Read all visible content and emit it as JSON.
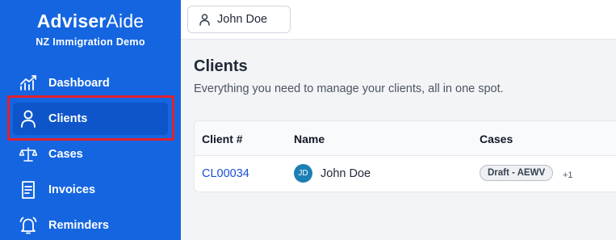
{
  "brand": {
    "title_bold": "Adviser",
    "title_light": "Aide",
    "subtitle": "NZ Immigration Demo"
  },
  "sidebar": {
    "items": [
      {
        "label": "Dashboard",
        "icon": "chart-icon"
      },
      {
        "label": "Clients",
        "icon": "user-icon",
        "active": true
      },
      {
        "label": "Cases",
        "icon": "scales-icon"
      },
      {
        "label": "Invoices",
        "icon": "invoice-icon"
      },
      {
        "label": "Reminders",
        "icon": "bell-icon"
      }
    ]
  },
  "topbar": {
    "user_name": "John Doe"
  },
  "page": {
    "title": "Clients",
    "subtitle": "Everything you need to manage your clients, all in one spot."
  },
  "table": {
    "headers": [
      "Client #",
      "Name",
      "Cases"
    ],
    "rows": [
      {
        "client_id": "CL00034",
        "initials": "JD",
        "name": "John Doe",
        "case_badge": "Draft - AEWV",
        "more": "+1"
      }
    ]
  },
  "colors": {
    "sidebar": "#1565e0",
    "active": "#0d55c8",
    "highlight": "#e0212e",
    "link": "#1d4ed8",
    "avatar": "#1d7fb3"
  }
}
